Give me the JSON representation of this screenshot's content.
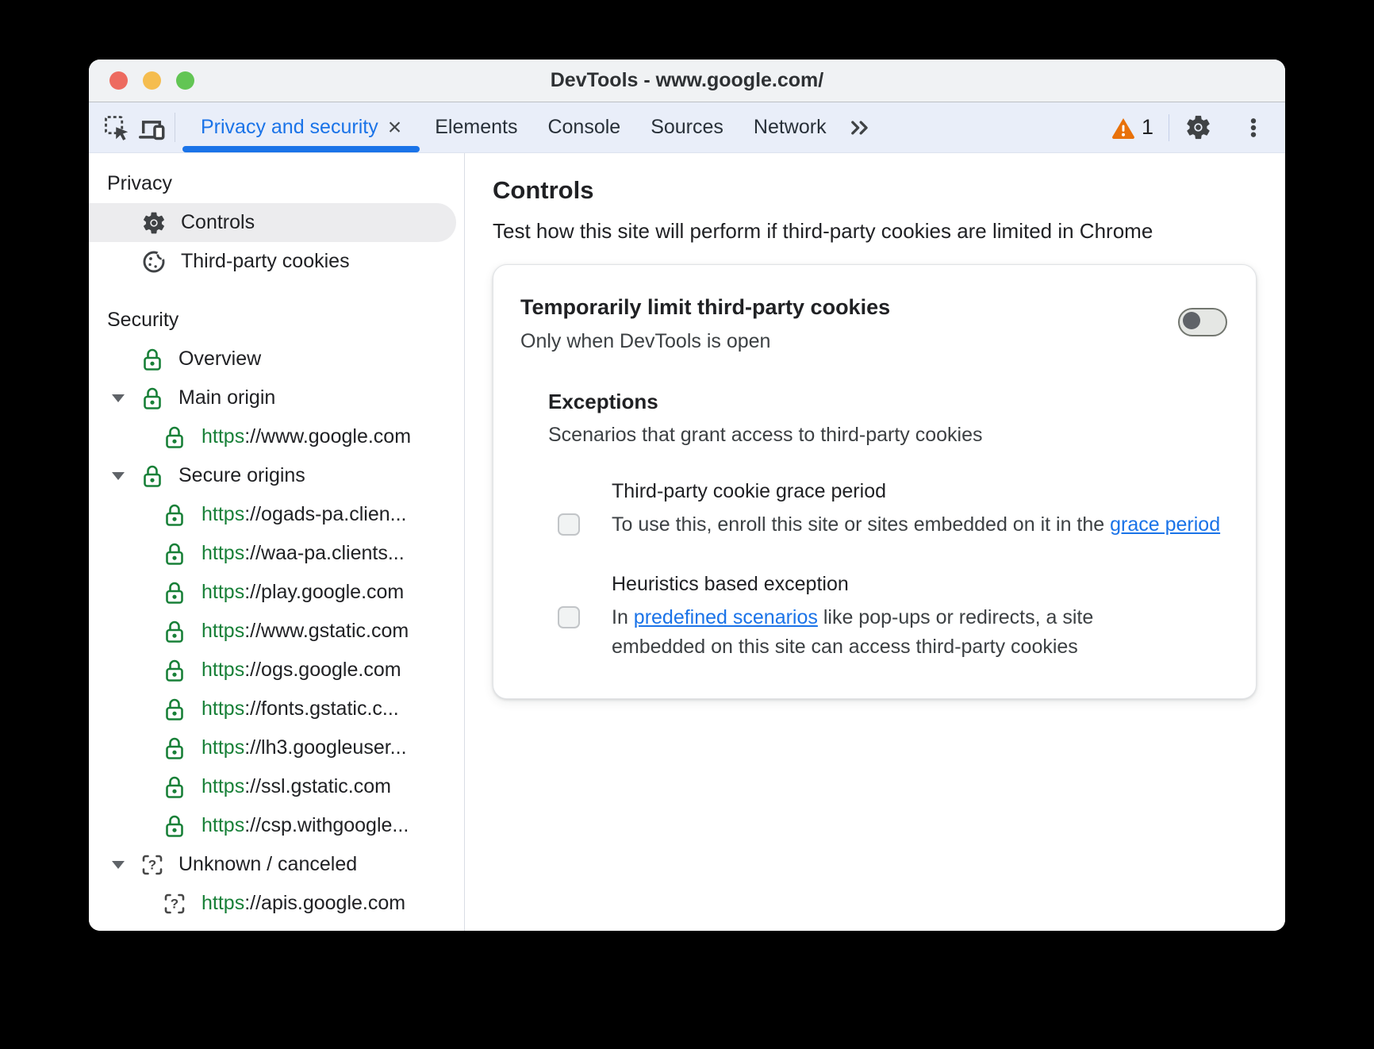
{
  "window": {
    "title": "DevTools - www.google.com/"
  },
  "tabbar": {
    "active_tab": {
      "label": "Privacy and security",
      "close": "×"
    },
    "tabs": [
      "Elements",
      "Console",
      "Sources",
      "Network"
    ],
    "warning_count": "1"
  },
  "icons": {
    "toolbar": [
      "inspect-cursor-icon",
      "device-toolbar-icon",
      "more-tabs-icon",
      "warning-icon",
      "gear-icon",
      "kebab-menu-icon"
    ],
    "sidebar": [
      "gear-icon",
      "cookie-icon",
      "lock-icon",
      "unknown-origin-icon",
      "expand-arrow-icon"
    ]
  },
  "colors": {
    "accent_blue": "#1a73e8",
    "secure_green": "#188038",
    "warning_orange": "#e8710a",
    "tabbar_bg": "#e9eef9",
    "selected_row_bg": "#ececee"
  },
  "sidebar": {
    "privacy_header": "Privacy",
    "controls_label": "Controls",
    "cookies_label": "Third-party cookies",
    "security_header": "Security",
    "overview_label": "Overview",
    "main_origin_label": "Main origin",
    "secure_origins_label": "Secure origins",
    "unknown_label": "Unknown / canceled",
    "origins": {
      "main": [
        {
          "scheme": "https",
          "rest": "://www.google.com"
        }
      ],
      "secure": [
        {
          "scheme": "https",
          "rest": "://ogads-pa.clien..."
        },
        {
          "scheme": "https",
          "rest": "://waa-pa.clients..."
        },
        {
          "scheme": "https",
          "rest": "://play.google.com"
        },
        {
          "scheme": "https",
          "rest": "://www.gstatic.com"
        },
        {
          "scheme": "https",
          "rest": "://ogs.google.com"
        },
        {
          "scheme": "https",
          "rest": "://fonts.gstatic.c..."
        },
        {
          "scheme": "https",
          "rest": "://lh3.googleuser..."
        },
        {
          "scheme": "https",
          "rest": "://ssl.gstatic.com"
        },
        {
          "scheme": "https",
          "rest": "://csp.withgoogle..."
        }
      ],
      "unknown": [
        {
          "scheme": "https",
          "rest": "://apis.google.com"
        }
      ]
    }
  },
  "main": {
    "title": "Controls",
    "subtitle": "Test how this site will perform if third-party cookies are limited in Chrome",
    "card": {
      "title": "Temporarily limit third-party cookies",
      "subtitle": "Only when DevTools is open",
      "toggle_state": "off",
      "exceptions_header": "Exceptions",
      "exceptions_subtitle": "Scenarios that grant access to third-party cookies",
      "items": [
        {
          "title": "Third-party cookie grace period",
          "desc_before": "To use this, enroll this site or sites embedded on it in the ",
          "link": "grace period",
          "desc_after": "",
          "checked": false
        },
        {
          "title": "Heuristics based exception",
          "desc_before": "In ",
          "link": "predefined scenarios",
          "desc_after": " like pop-ups or redirects, a site embedded on this site can access third-party cookies",
          "checked": false
        }
      ]
    }
  }
}
